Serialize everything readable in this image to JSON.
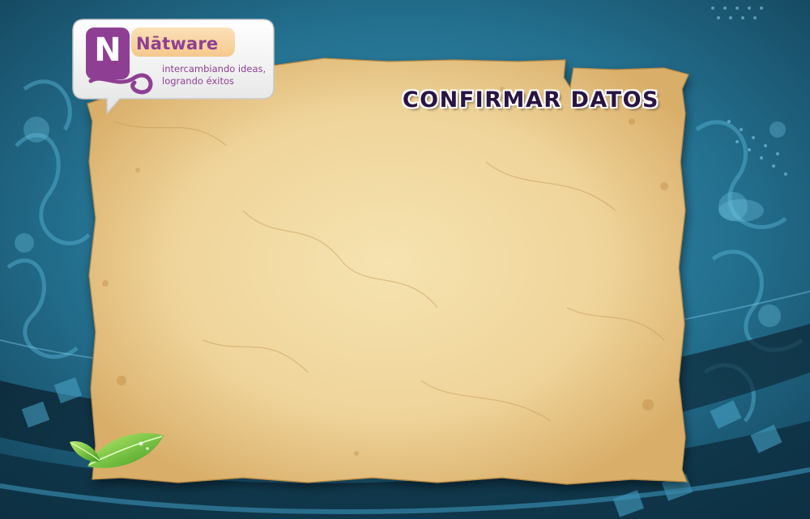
{
  "brand": {
    "logo_letter": "N",
    "name": "Nātware",
    "tagline_line1": "intercambiando ideas,",
    "tagline_line2": "logrando éxitos"
  },
  "page": {
    "title": "CONFIRMAR DATOS"
  },
  "colors": {
    "background": "#1f6f8f",
    "background_dark": "#0d3548",
    "brand_purple": "#8e3f93",
    "parchment": "#f0d9a2",
    "title_text": "#2a1442",
    "leaf_green": "#7ac943"
  }
}
